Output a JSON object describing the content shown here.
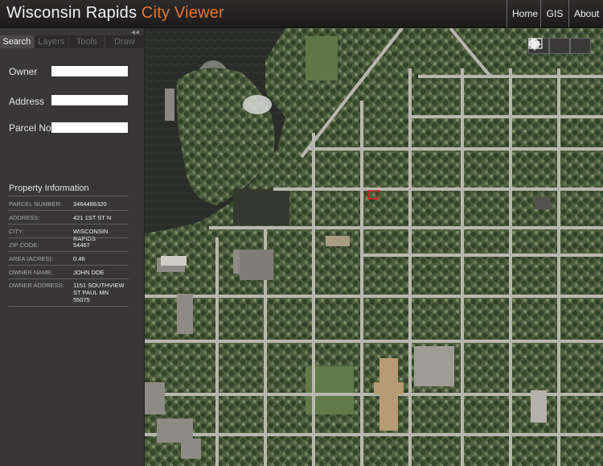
{
  "header": {
    "title_main": "Wisconsin Rapids",
    "title_accent": "City Viewer",
    "nav": [
      "Home",
      "GIS",
      "About"
    ]
  },
  "panel": {
    "collapse_glyph": "◂◂",
    "tabs": [
      "Search",
      "Layers",
      "Tools",
      "Draw"
    ],
    "active_tab": "Search",
    "search_fields": {
      "owner_label": "Owner",
      "owner_value": "",
      "address_label": "Address",
      "address_value": "",
      "parcel_label": "Parcel No.",
      "parcel_value": ""
    },
    "property": {
      "title": "Property Information",
      "rows": [
        {
          "key": "PARCEL NUMBER:",
          "value": "3464486320"
        },
        {
          "key": "ADDRESS:",
          "value": "421 1ST ST N"
        },
        {
          "key": "CITY:",
          "value": "WISCONSIN RAPIDS"
        },
        {
          "key": "ZIP CODE:",
          "value": "54467"
        },
        {
          "key": "AREA (ACRES):",
          "value": "0.46"
        },
        {
          "key": "OWNER NAME:",
          "value": "JOHN DOE"
        },
        {
          "key": "OWNER ADDRESS:",
          "value": "1151 SOUTHVIEW\nST PAUL MN\n55075"
        }
      ]
    }
  },
  "map": {
    "tools": [
      "globe-icon",
      "crosshair-icon",
      "fullscreen-icon"
    ],
    "colors": {
      "water": "#2b2d2a",
      "vegetation": "#3f5234",
      "street": "#b8b6ab",
      "building": "#8f8c86",
      "selection": "#e02020"
    }
  }
}
